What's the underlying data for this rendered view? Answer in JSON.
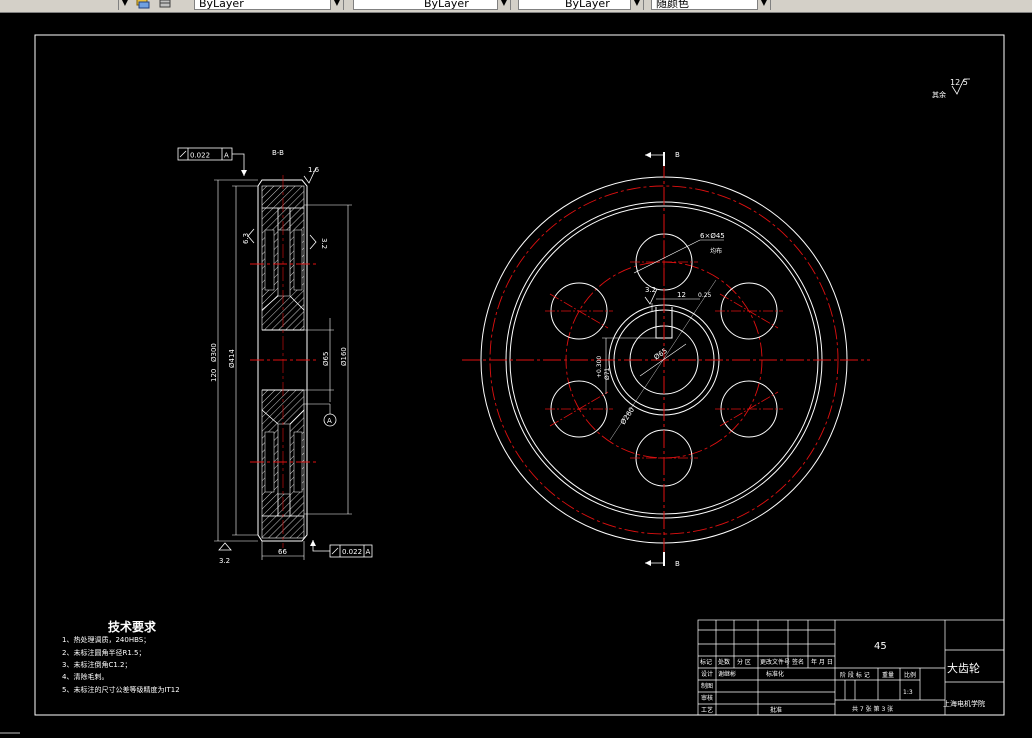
{
  "toolbar": {
    "layer_dropdown": "ByLayer",
    "linetype_dropdown": "ByLayer",
    "lineweight_dropdown": "ByLayer",
    "color_dropdown": "随颜色"
  },
  "section_view": {
    "section_label": "B-B",
    "tolerance_top": "0.022",
    "datum_top": "A",
    "tolerance_bottom": "0.022",
    "datum_bottom": "A",
    "datum_circle": "A",
    "roughness_top": "1.6",
    "roughness_left": "6.3",
    "roughness_right": "3.2",
    "roughness_bottom": "3.2",
    "dim_outer": "Ø414",
    "dim_tip": "Ø300",
    "dim_overall": "120",
    "dim_hub1": "Ø65",
    "dim_hub2": "Ø160",
    "dim_width": "66"
  },
  "front_view": {
    "cut_label_top": "B",
    "cut_label_bottom": "B",
    "roughness_key": "3.2",
    "dim_holes": "6×Ø45",
    "dim_holes_note": "均布",
    "dim_key_width": "12",
    "dim_key_tol": "0.25",
    "dim_key_depth": "+0.300",
    "dim_key_depth2": "Ø71",
    "dim_bore": "Ø65",
    "dim_pcd": "Ø260"
  },
  "roughness_general": {
    "label": "其余",
    "value": "12.5"
  },
  "tech_req": {
    "title": "技术要求",
    "items": [
      "1、热处理调质，240HBS；",
      "2、未标注圆角半径R1.5；",
      "3、未标注倒角C1.2；",
      "4、清除毛刺。",
      "5、未标注的尺寸公差等级精度为IT12"
    ]
  },
  "title_block": {
    "material": "45",
    "part_name": "大齿轮",
    "company": "上海电机学院",
    "scale": "1:3",
    "sheet": "共 7 张  第 3 张",
    "row_headers": [
      "标记",
      "处数",
      "分 区",
      "更改文件号",
      "签名",
      "年 月 日"
    ],
    "roles": [
      "设计",
      "制图",
      "审核",
      "工艺"
    ],
    "designer": "谢继彬",
    "standardize": "标准化",
    "approve": "批准",
    "stage_labels": [
      "阶 段 标 记",
      "重量",
      "比例"
    ]
  }
}
